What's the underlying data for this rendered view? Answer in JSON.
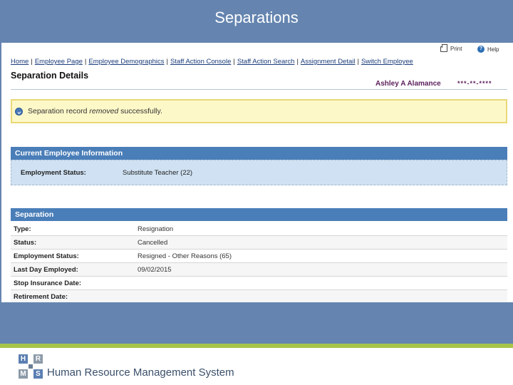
{
  "banner": {
    "title": "Separations"
  },
  "toolbar": {
    "print_label": "Print",
    "help_label": "Help",
    "help_glyph": "?"
  },
  "breadcrumb": [
    "Home",
    "Employee Page",
    "Employee Demographics",
    "Staff Action Console",
    "Staff Action Search",
    "Assignment Detail",
    "Switch Employee"
  ],
  "page": {
    "title": "Separation Details",
    "employee_name": "Ashley A Alamance",
    "employee_id": "***-**-****"
  },
  "message": {
    "prefix": "Separation record ",
    "emphasis": "removed",
    "suffix": " successfully."
  },
  "current_employee": {
    "heading": "Current Employee Information",
    "label": "Employment Status:",
    "value": "Substitute Teacher (22)"
  },
  "separation": {
    "heading": "Separation",
    "rows": [
      {
        "label": "Type:",
        "value": "Resignation"
      },
      {
        "label": "Status:",
        "value": "Cancelled"
      },
      {
        "label": "Employment Status:",
        "value": "Resigned - Other Reasons (65)"
      },
      {
        "label": "Last Day Employed:",
        "value": "09/02/2015"
      },
      {
        "label": "Stop Insurance Date:",
        "value": ""
      },
      {
        "label": "Retirement Date:",
        "value": ""
      }
    ]
  },
  "footer": {
    "logo_letters": [
      "H",
      "R",
      "M",
      "S"
    ],
    "text": "Human Resource Management System"
  },
  "colors": {
    "banner": "#6585b0",
    "section_header": "#4a7eb8",
    "message_bg": "#fdf8c8",
    "green_strip": "#a8c54a",
    "logo_blue": "#5b7fb2",
    "logo_gray": "#8c9aa8"
  }
}
